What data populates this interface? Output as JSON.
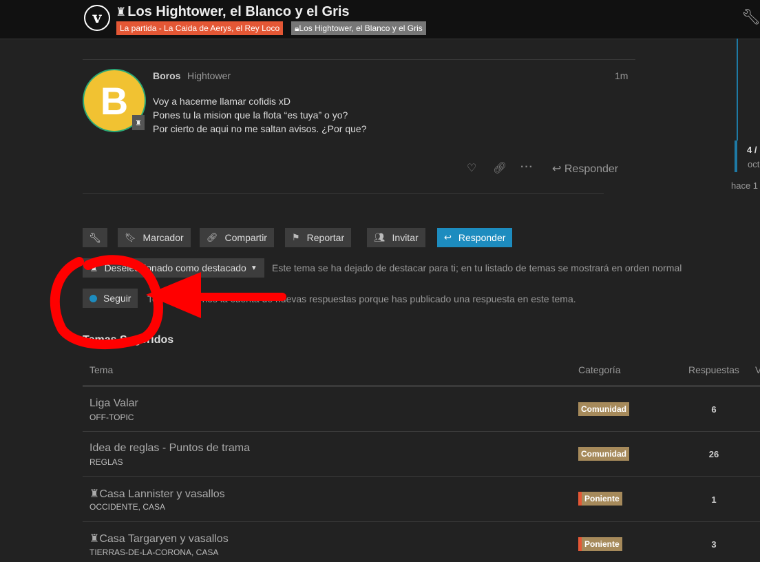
{
  "header": {
    "logo_letter": "v",
    "title": "Los Hightower, el Blanco y el Gris",
    "category": "La partida - La Caida de Aerys, el Rey Loco",
    "subcategory": "Los Hightower, el Blanco y el Gris"
  },
  "timeline": {
    "position": "4 /",
    "date": "oct",
    "ago": "hace 1"
  },
  "post": {
    "username": "Boros",
    "user_title": "Hightower",
    "avatar_letter": "B",
    "age": "1m",
    "lines": [
      "Voy a hacerme llamar cofidis xD",
      "Pones tu la mision que la flota “es tuya” o yo?",
      "Por cierto de aqui no me saltan avisos. ¿Por que?"
    ],
    "reply_label": "Responder"
  },
  "footer_buttons": {
    "bookmark": "Marcador",
    "share": "Compartir",
    "flag": "Reportar",
    "invite": "Invitar",
    "reply": "Responder"
  },
  "pin_control": {
    "label": "Deseleccionado como destacado",
    "text": "Este tema se ha dejado de destacar para ti; en tu listado de temas se mostrará en orden normal"
  },
  "notifications": {
    "label": "Seguir",
    "text": "Te notificaremos la cuenta de nuevas respuestas porque has publicado una respuesta en este tema."
  },
  "suggested": {
    "heading": "Temas Sugeridos",
    "columns": {
      "topic": "Tema",
      "category": "Categoría",
      "replies": "Respuestas",
      "views": "V"
    },
    "rows": [
      {
        "title": "Liga Valar",
        "tags": "OFF-TOPIC",
        "category": "Comunidad",
        "replies": "6"
      },
      {
        "title": "Idea de reglas - Puntos de trama",
        "tags": "REGLAS",
        "category": "Comunidad",
        "replies": "26"
      },
      {
        "title": "Casa Lannister y vasallos",
        "tags": "OCCIDENTE, CASA",
        "category": "Poniente",
        "replies": "1"
      },
      {
        "title": "Casa Targaryen y vasallos",
        "tags": "TIERRAS-DE-LA-CORONA, CASA",
        "category": "Poniente",
        "replies": "3"
      }
    ]
  },
  "colors": {
    "accent": "#1d8cbf",
    "category_red": "#e45735",
    "category_tan": "#a68a5b",
    "annotation_red": "#ff0000"
  }
}
